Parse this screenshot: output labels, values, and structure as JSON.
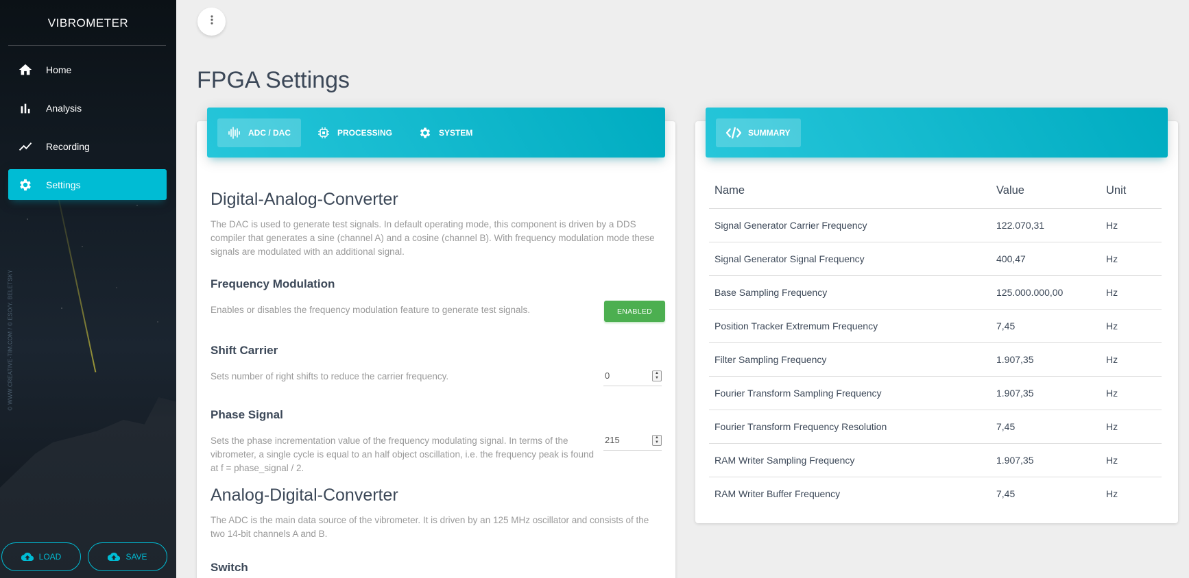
{
  "sidebar": {
    "brand": "VIBROMETER",
    "credit": "© WWW.CREATIVE-TIM.COM / © ESO/Y. BELETSKY",
    "items": [
      {
        "label": "Home",
        "icon": "home-icon"
      },
      {
        "label": "Analysis",
        "icon": "bar-chart-icon"
      },
      {
        "label": "Recording",
        "icon": "line-chart-icon"
      },
      {
        "label": "Settings",
        "icon": "gear-icon"
      }
    ],
    "load_label": "LOAD",
    "save_label": "SAVE"
  },
  "page": {
    "title": "FPGA Settings"
  },
  "tabs": [
    {
      "label": "ADC / DAC",
      "icon": "waveform-icon"
    },
    {
      "label": "PROCESSING",
      "icon": "chip-icon"
    },
    {
      "label": "SYSTEM",
      "icon": "gear-icon"
    }
  ],
  "summary_tab": {
    "label": "SUMMARY",
    "icon": "code-icon"
  },
  "dac": {
    "title": "Digital-Analog-Converter",
    "desc": "The DAC is used to generate test signals. In default operating mode, this component is driven by a DDS compiler that generates a sine (channel A) and a cosine (channel B). With frequency modulation mode these signals are modulated with an additional signal.",
    "fm": {
      "title": "Frequency Modulation",
      "desc": "Enables or disables the frequency modulation feature to generate test signals.",
      "button": "ENABLED"
    },
    "shift": {
      "title": "Shift Carrier",
      "desc": "Sets number of right shifts to reduce the carrier frequency.",
      "value": "0"
    },
    "phase": {
      "title": "Phase Signal",
      "desc": "Sets the phase incrementation value of the frequency modulating signal. In terms of the vibrometer, a single cycle is equal to an half object oscillation, i.e. the frequency peak is found at f = phase_signal / 2.",
      "value": "215"
    }
  },
  "adc": {
    "title": "Analog-Digital-Converter",
    "desc": "The ADC is the main data source of the vibrometer. It is driven by an 125 MHz oscillator and consists of the two 14-bit channels A and B.",
    "switch_title": "Switch"
  },
  "summary": {
    "headers": [
      "Name",
      "Value",
      "Unit"
    ],
    "rows": [
      [
        "Signal Generator Carrier Frequency",
        "122.070,31",
        "Hz"
      ],
      [
        "Signal Generator Signal Frequency",
        "400,47",
        "Hz"
      ],
      [
        "Base Sampling Frequency",
        "125.000.000,00",
        "Hz"
      ],
      [
        "Position Tracker Extremum Frequency",
        "7,45",
        "Hz"
      ],
      [
        "Filter Sampling Frequency",
        "1.907,35",
        "Hz"
      ],
      [
        "Fourier Transform Sampling Frequency",
        "1.907,35",
        "Hz"
      ],
      [
        "Fourier Transform Frequency Resolution",
        "7,45",
        "Hz"
      ],
      [
        "RAM Writer Sampling Frequency",
        "1.907,35",
        "Hz"
      ],
      [
        "RAM Writer Buffer Frequency",
        "7,45",
        "Hz"
      ]
    ]
  },
  "colors": {
    "accent": "#00bcd4",
    "success": "#4caf50"
  }
}
